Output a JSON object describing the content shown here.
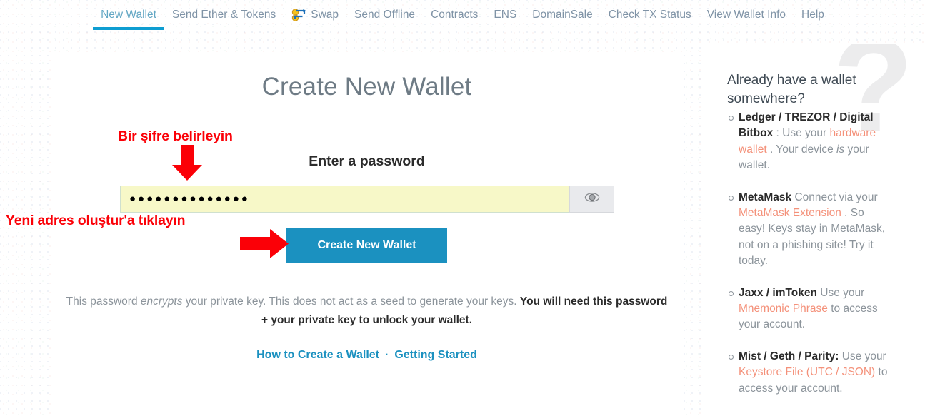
{
  "nav": {
    "items": [
      {
        "label": "New Wallet",
        "active": true,
        "icon": null
      },
      {
        "label": "Send Ether & Tokens",
        "active": false,
        "icon": null
      },
      {
        "label": "Swap",
        "active": false,
        "icon": "swap-coins-icon"
      },
      {
        "label": "Send Offline",
        "active": false,
        "icon": null
      },
      {
        "label": "Contracts",
        "active": false,
        "icon": null
      },
      {
        "label": "ENS",
        "active": false,
        "icon": null
      },
      {
        "label": "DomainSale",
        "active": false,
        "icon": null
      },
      {
        "label": "Check TX Status",
        "active": false,
        "icon": null
      },
      {
        "label": "View Wallet Info",
        "active": false,
        "icon": null
      },
      {
        "label": "Help",
        "active": false,
        "icon": null
      }
    ]
  },
  "main": {
    "title": "Create New Wallet",
    "password_label": "Enter a password",
    "password_value": "●●●●●●●●●●●●●●",
    "password_placeholder": "",
    "password_toggle_icon": "eye-icon",
    "create_button": "Create New Wallet",
    "explain": {
      "part1": "This password ",
      "emphasis": "encrypts",
      "part2": " your private key. This does not act as a seed to generate your keys. ",
      "bold": "You will need this password + your private key to unlock your wallet."
    },
    "links": {
      "first": "How to Create a Wallet",
      "separator": "·",
      "second": "Getting Started"
    }
  },
  "sidebar": {
    "watermark": "?",
    "title": "Already have a wallet somewhere?",
    "items": [
      {
        "name": "Ledger / TREZOR / Digital Bitbox",
        "segments": [
          {
            "text": "Ledger / TREZOR / Digital Bitbox",
            "style": "bold"
          },
          {
            "text": " : Use your ",
            "style": "normal"
          },
          {
            "text": "hardware wallet",
            "style": "link"
          },
          {
            "text": " . Your device ",
            "style": "normal"
          },
          {
            "text": "is",
            "style": "italic"
          },
          {
            "text": " your wallet.",
            "style": "normal"
          }
        ]
      },
      {
        "name": "MetaMask",
        "segments": [
          {
            "text": "MetaMask",
            "style": "bold"
          },
          {
            "text": " Connect via your ",
            "style": "normal"
          },
          {
            "text": "MetaMask Extension",
            "style": "link"
          },
          {
            "text": " . So easy! Keys stay in MetaMask, not on a phishing site! Try it today.",
            "style": "normal"
          }
        ]
      },
      {
        "name": "Jaxx / imToken",
        "segments": [
          {
            "text": "Jaxx / imToken",
            "style": "bold"
          },
          {
            "text": " Use your ",
            "style": "normal"
          },
          {
            "text": "Mnemonic Phrase",
            "style": "link"
          },
          {
            "text": " to access your account.",
            "style": "normal"
          }
        ]
      },
      {
        "name": "Mist / Geth / Parity",
        "segments": [
          {
            "text": "Mist / Geth / Parity:",
            "style": "bold"
          },
          {
            "text": " Use your ",
            "style": "normal"
          },
          {
            "text": "Keystore File (UTC / JSON)",
            "style": "link"
          },
          {
            "text": " to access your account.",
            "style": "normal"
          }
        ]
      }
    ]
  },
  "annotations": {
    "password_note": "Bir şifre belirleyin",
    "button_note": "Yeni adres oluştur'a tıklayın",
    "arrow_down": "red-down-arrow-icon",
    "arrow_right": "red-right-arrow-icon",
    "color": "#fb0007"
  },
  "colors": {
    "accent_blue": "#1b91c0",
    "nav_active_underline": "#0e9dd1",
    "link_salmon": "#f4917a",
    "autofill_yellow": "#f7f8c8"
  }
}
